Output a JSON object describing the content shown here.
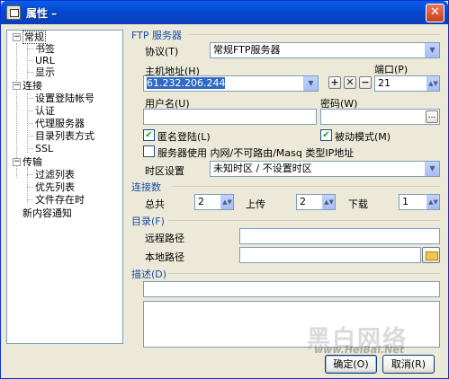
{
  "window": {
    "title": "属性 –",
    "close_label": "✕"
  },
  "tree": {
    "items": [
      {
        "label": "常规",
        "expanded": true,
        "selected": true
      },
      {
        "label": "书签"
      },
      {
        "label": "URL"
      },
      {
        "label": "显示"
      },
      {
        "label": "连接",
        "expanded": true
      },
      {
        "label": "设置登陆帐号"
      },
      {
        "label": "认证"
      },
      {
        "label": "代理服务器"
      },
      {
        "label": "目录列表方式"
      },
      {
        "label": "SSL"
      },
      {
        "label": "传输",
        "expanded": true
      },
      {
        "label": "过滤列表"
      },
      {
        "label": "优先列表"
      },
      {
        "label": "文件存在时"
      },
      {
        "label": "新内容通知"
      }
    ],
    "toggle_minus": "−"
  },
  "ftp": {
    "section_title": "FTP 服务器",
    "protocol_label": "协议(T)",
    "protocol_value": "常规FTP服务器",
    "host_label": "主机地址(H)",
    "host_value": "61.232.206.244",
    "port_label": "端口(P)",
    "port_value": "21",
    "username_label": "用户名(U)",
    "username_value": "",
    "password_label": "密码(W)",
    "password_value": "",
    "password_btn": "...",
    "anonymous_label": "匿名登陆(L)",
    "anonymous_checked": true,
    "passive_label": "被动模式(M)",
    "passive_checked": true,
    "intranet_label": "服务器使用 内网/不可路由/Masq 类型IP地址",
    "intranet_checked": false,
    "timezone_label": "时区设置",
    "timezone_value": "未知时区 / 不设置时区",
    "check_mark": "✔",
    "host_btn_add": "+",
    "host_btn_remove": "✕",
    "host_btn_minus": "−",
    "dropdown_arrow": "▼"
  },
  "connections": {
    "section_title": "连接数",
    "total_label": "总共",
    "total_value": "2",
    "upload_label": "上传",
    "upload_value": "2",
    "download_label": "下载",
    "download_value": "1",
    "spin_arrow": "▲▼"
  },
  "directory": {
    "section_title": "目录(F)",
    "remote_label": "远程路径",
    "remote_value": "",
    "local_label": "本地路径",
    "local_value": ""
  },
  "description": {
    "section_title": "描述(D)",
    "value": ""
  },
  "buttons": {
    "ok": "确定(O)",
    "cancel": "取消(R)"
  },
  "watermark": {
    "big": "黑白网络",
    "small": "www.HeiBai.Net"
  },
  "colors": {
    "titlebar": "#0349d0",
    "section_title": "#1b4fa8",
    "selection": "#316ac5",
    "check": "#21a121"
  }
}
